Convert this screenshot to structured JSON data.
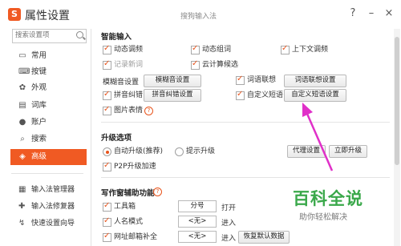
{
  "window": {
    "title": "属性设置",
    "subtitle": "搜狗输入法",
    "help": "?",
    "minimize": "–",
    "close": "×"
  },
  "sidebar": {
    "search_placeholder": "搜索设置项",
    "items": [
      {
        "label": "常用",
        "icon": "monitor-icon",
        "glyph": "▭"
      },
      {
        "label": "按键",
        "icon": "keyboard-icon",
        "glyph": "⌨"
      },
      {
        "label": "外观",
        "icon": "palette-icon",
        "glyph": "✿"
      },
      {
        "label": "词库",
        "icon": "book-icon",
        "glyph": "▤"
      },
      {
        "label": "账户",
        "icon": "user-icon",
        "glyph": "●"
      },
      {
        "label": "搜索",
        "icon": "search-icon",
        "glyph": "⌕"
      },
      {
        "label": "高级",
        "icon": "advanced-icon",
        "glyph": "◈"
      }
    ],
    "tools": [
      {
        "label": "输入法管理器",
        "icon": "manager-icon",
        "glyph": "▦"
      },
      {
        "label": "输入法修复器",
        "icon": "repair-icon",
        "glyph": "✚"
      },
      {
        "label": "快速设置向导",
        "icon": "wizard-icon",
        "glyph": "↯"
      }
    ]
  },
  "smart": {
    "heading": "智能输入",
    "dynamic_adjust": "动态调频",
    "dynamic_compose": "动态组词",
    "context_adjust": "上下文调频",
    "remember_new": "记录新词",
    "cloud": "云计算候选",
    "fuzzy_label": "模糊音设置",
    "fuzzy_btn": "模糊音设置",
    "phrase_assoc": "词语联想",
    "phrase_assoc_btn": "词语联想设置",
    "pinyin_fix": "拼音纠错",
    "pinyin_fix_btn": "拼音纠错设置",
    "custom_phrase": "自定义短语",
    "custom_phrase_btn": "自定义短语设置",
    "picture_emoji": "图片表情"
  },
  "upgrade": {
    "heading": "升级选项",
    "auto": "自动升级(推荐)",
    "prompt": "提示升级",
    "proxy_btn": "代理设置",
    "now_btn": "立即升级",
    "p2p": "P2P升级加速"
  },
  "writer": {
    "heading": "写作窗辅助功能",
    "toolbox": "工具箱",
    "toolbox_key": "分号",
    "toolbox_action": "打开",
    "persona": "人名模式",
    "persona_key": "<无>",
    "persona_action": "进入",
    "email": "网址邮箱补全",
    "email_key": "<无>",
    "email_action": "进入",
    "restore_btn": "恢复默认数据"
  },
  "watermark": {
    "big": "百科全说",
    "small": "助你轻松解决"
  },
  "colors": {
    "accent": "#f05a23",
    "arrow": "#e030c8",
    "watermark": "#3aa84a"
  }
}
